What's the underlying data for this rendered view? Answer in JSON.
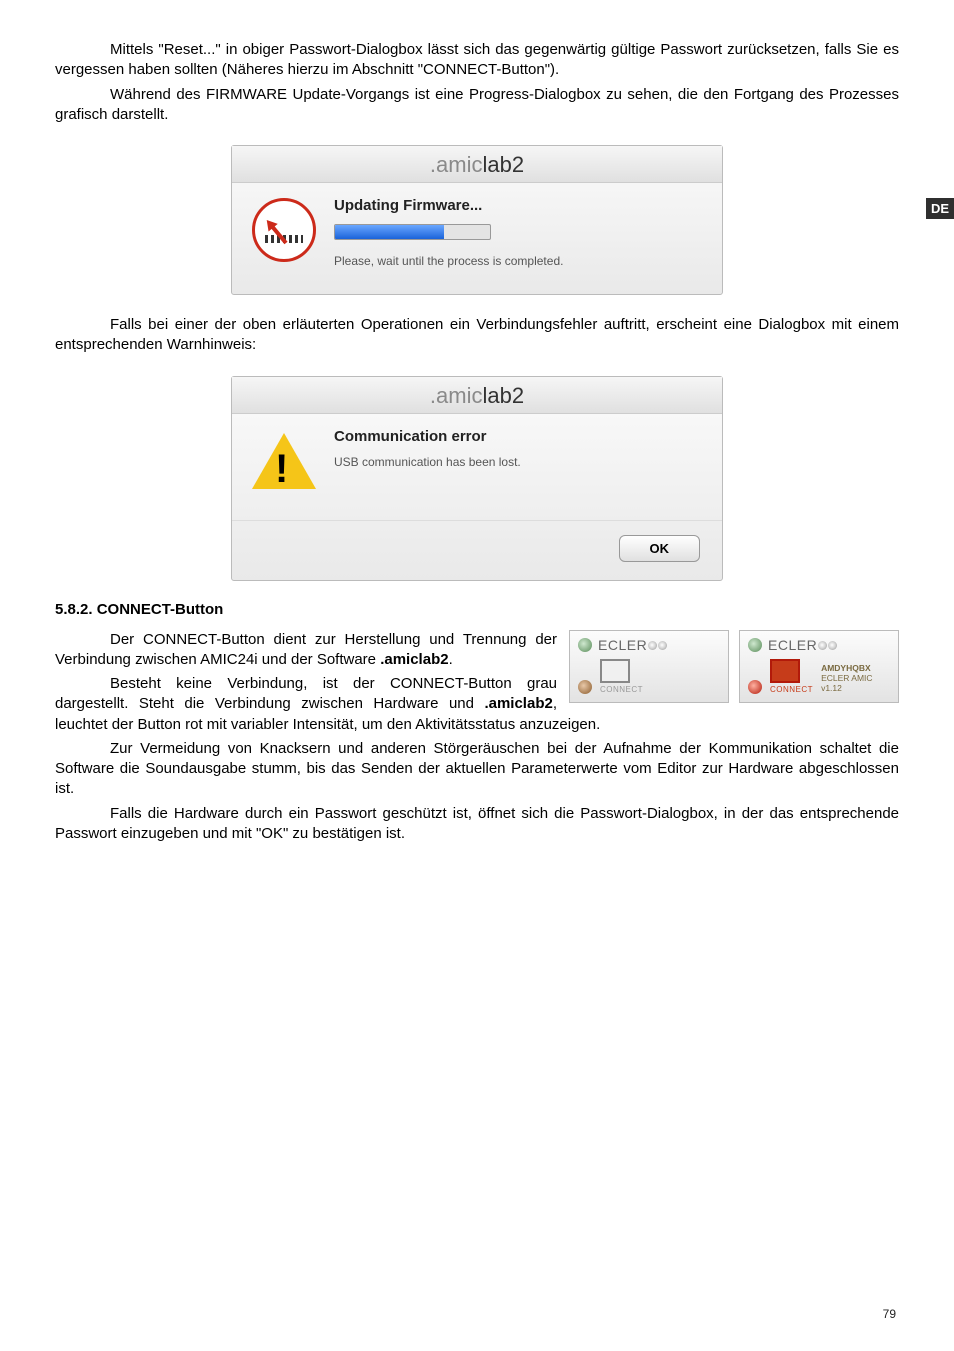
{
  "para1": "Mittels \"Reset...\" in obiger Passwort-Dialogbox lässt sich das gegenwärtig gültige Passwort zurücksetzen, falls Sie es vergessen haben sollten (Näheres hierzu im Abschnitt \"CONNECT-Button\").",
  "para2": "Während des FIRMWARE Update-Vorgangs ist eine Progress-Dialogbox zu sehen, die den Fortgang des Prozesses grafisch darstellt.",
  "dialog1": {
    "title_prefix": ".amic",
    "title_suffix": "lab2",
    "heading": "Updating Firmware...",
    "subtext": "Please, wait until the process is completed."
  },
  "para3": "Falls bei einer der oben erläuterten Operationen ein Verbindungsfehler auftritt, erscheint eine Dialogbox mit einem entsprechenden Warnhinweis:",
  "dialog2": {
    "title_prefix": ".amic",
    "title_suffix": "lab2",
    "heading": "Communication error",
    "subtext": "USB communication has been lost.",
    "ok": "OK"
  },
  "section_heading": "5.8.2. CONNECT-Button",
  "connect_para1a": "Der CONNECT-Button dient zur Herstellung und Trennung der Verbindung zwischen AMIC24i und der Software ",
  "connect_para1b": ".amiclab2",
  "connect_para1c": ".",
  "connect_para2a": "Besteht keine Verbindung, ist der CONNECT-Button grau dargestellt. Steht die Verbindung zwischen Hardware und ",
  "connect_para2b": ".amiclab2",
  "connect_para2c": ", leuchtet der Button rot mit variabler Intensität, um den Aktivitätsstatus anzuzeigen.",
  "connect_para3": "Zur Vermeidung von Knacksern und anderen Störgeräuschen bei der Aufnahme der Kommunikation schaltet die Software die Soundausgabe stumm, bis das Senden der aktuellen Parameterwerte vom Editor zur Hardware abgeschlossen ist.",
  "connect_para4": "Falls die Hardware durch ein Passwort geschützt ist, öffnet sich die Passwort-Dialogbox, in der das entsprechende Passwort einzugeben und mit \"OK\" zu bestätigen ist.",
  "toolbar": {
    "logo": "ECLER",
    "connect_label": "CONNECT",
    "device_line1": "AMDYHQBX",
    "device_line2": "ECLER AMIC",
    "device_line3": "v1.12"
  },
  "badge": "DE",
  "page": "79"
}
